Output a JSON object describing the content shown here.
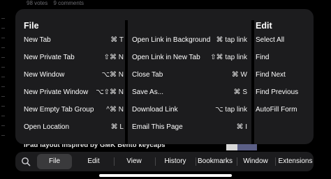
{
  "background": {
    "votes": "98 votes",
    "comments": "9 comments",
    "headline": "iPad layout inspired by GMK Bento keycaps"
  },
  "menu": {
    "file": {
      "title": "File",
      "items": [
        {
          "label": "New Tab",
          "shortcut": "⌘ T"
        },
        {
          "label": "New Private Tab",
          "shortcut": "⇧⌘ N"
        },
        {
          "label": "New Window",
          "shortcut": "⌥⌘ N"
        },
        {
          "label": "New Private Window",
          "shortcut": "⌥⇧⌘ N"
        },
        {
          "label": "New Empty Tab Group",
          "shortcut": "^⌘ N"
        },
        {
          "label": "Open Location",
          "shortcut": "⌘ L"
        }
      ]
    },
    "links": {
      "items": [
        {
          "label": "Open Link in Background",
          "shortcut": "⌘ tap link"
        },
        {
          "label": "Open Link in New Tab",
          "shortcut": "⇧⌘ tap link"
        },
        {
          "label": "Close Tab",
          "shortcut": "⌘ W"
        },
        {
          "label": "Save As...",
          "shortcut": "⌘ S"
        },
        {
          "label": "Download Link",
          "shortcut": "⌥ tap link"
        },
        {
          "label": "Email This Page",
          "shortcut": "⌘ I"
        }
      ]
    },
    "edit": {
      "title": "Edit",
      "items": [
        {
          "label": "Select All"
        },
        {
          "label": "Find"
        },
        {
          "label": "Find Next"
        },
        {
          "label": "Find Previous"
        },
        {
          "label": "AutoFill Form"
        }
      ]
    }
  },
  "menubar": {
    "search_icon": "search-icon",
    "items": [
      {
        "label": "File",
        "active": true
      },
      {
        "label": "Edit"
      },
      {
        "label": "View"
      },
      {
        "label": "History"
      },
      {
        "label": "Bookmarks"
      },
      {
        "label": "Window"
      },
      {
        "label": "Extensions"
      }
    ]
  },
  "colors": {
    "panel": "#1c1c1e",
    "active_tab": "#3a3a3c",
    "text": "#ffffff"
  }
}
